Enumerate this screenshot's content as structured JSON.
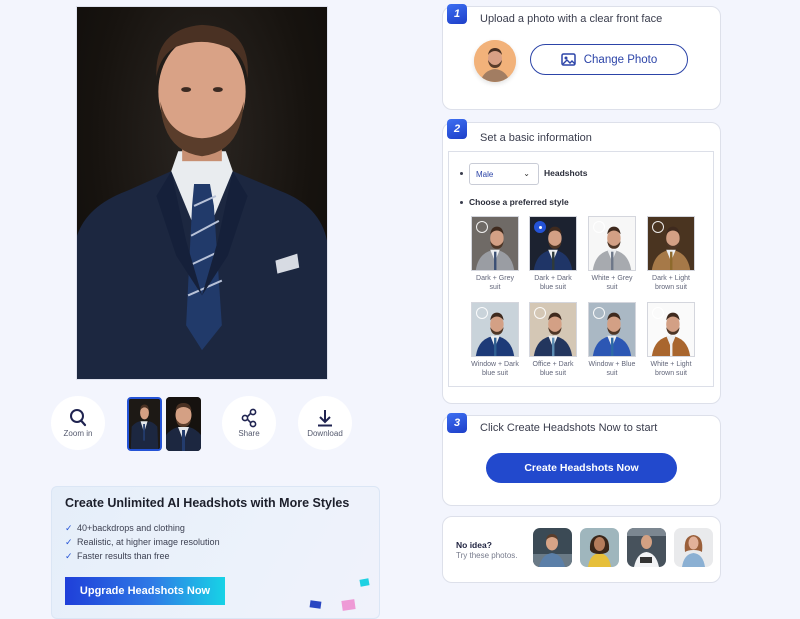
{
  "preview": {
    "main_photo_alt": "Generated headshot: man in dark blue suit on dark background",
    "tools": [
      {
        "label": "Zoom in",
        "icon": "zoom-in-icon"
      },
      {
        "label": "Share",
        "icon": "share-icon"
      },
      {
        "label": "Download",
        "icon": "download-icon"
      }
    ],
    "thumbnails": [
      {
        "desc": "Full-body headshot, dark blue suit",
        "selected": true
      },
      {
        "desc": "Close-up headshot, dark blue suit",
        "selected": false
      }
    ]
  },
  "promo": {
    "title": "Create Unlimited AI Headshots with More Styles",
    "features": [
      "40+backdrops and clothing",
      "Realistic, at higher image resolution",
      "Faster results than free"
    ],
    "button_label": "Upgrade Headshots Now"
  },
  "step1": {
    "number": "1",
    "title": "Upload a photo with a clear front face",
    "button_label": "Change Photo",
    "button_icon": "image-icon"
  },
  "step2": {
    "number": "2",
    "title": "Set a basic information",
    "gender_selected": "Male",
    "gender_suffix": "Headshots",
    "style_prompt": "Choose a preferred style",
    "styles": [
      {
        "label": "Dark + Grey suit",
        "selected": false
      },
      {
        "label": "Dark + Dark blue suit",
        "selected": true
      },
      {
        "label": "White + Grey suit",
        "selected": false
      },
      {
        "label": "Dark + Light brown suit",
        "selected": false
      },
      {
        "label": "Window + Dark blue suit",
        "selected": false
      },
      {
        "label": "Office + Dark blue suit",
        "selected": false
      },
      {
        "label": "Window + Blue suit",
        "selected": false
      },
      {
        "label": "White + Light brown suit",
        "selected": false
      }
    ]
  },
  "step3": {
    "number": "3",
    "title": "Click Create Headshots Now to start",
    "button_label": "Create Headshots Now"
  },
  "samples": {
    "title": "No idea?",
    "subtitle": "Try these photos.",
    "photos": [
      "Man with glasses in denim shirt",
      "Woman in yellow top with backpack",
      "Man in white shirt holding tablet",
      "Woman in denim jacket"
    ]
  },
  "colors": {
    "accent": "#2249cd",
    "background": "#f3f5fd",
    "card": "#ffffff"
  }
}
